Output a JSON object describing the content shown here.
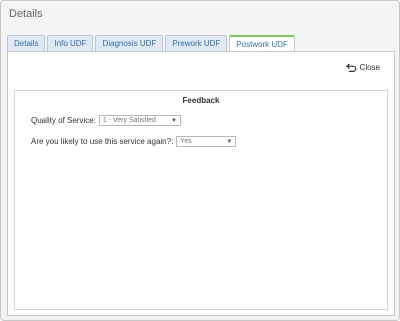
{
  "window": {
    "title": "Details"
  },
  "tabs": [
    {
      "label": "Details",
      "active": false
    },
    {
      "label": "Info UDF",
      "active": false
    },
    {
      "label": "Diagnosis UDF",
      "active": false
    },
    {
      "label": "Prework UDF",
      "active": false
    },
    {
      "label": "Postwork UDF",
      "active": true
    }
  ],
  "toolbar": {
    "close_label": "Close",
    "close_icon": "undo-arrow-icon"
  },
  "feedback": {
    "title": "Feedback",
    "quality": {
      "label": "Quality of Service:",
      "value": "1 - Very Satisfied"
    },
    "reuse": {
      "label": "Are you likely to use this service again?:",
      "value": "Yes"
    }
  },
  "colors": {
    "tab_text": "#2f6fb5",
    "active_tab_accent": "#6bd64a"
  }
}
